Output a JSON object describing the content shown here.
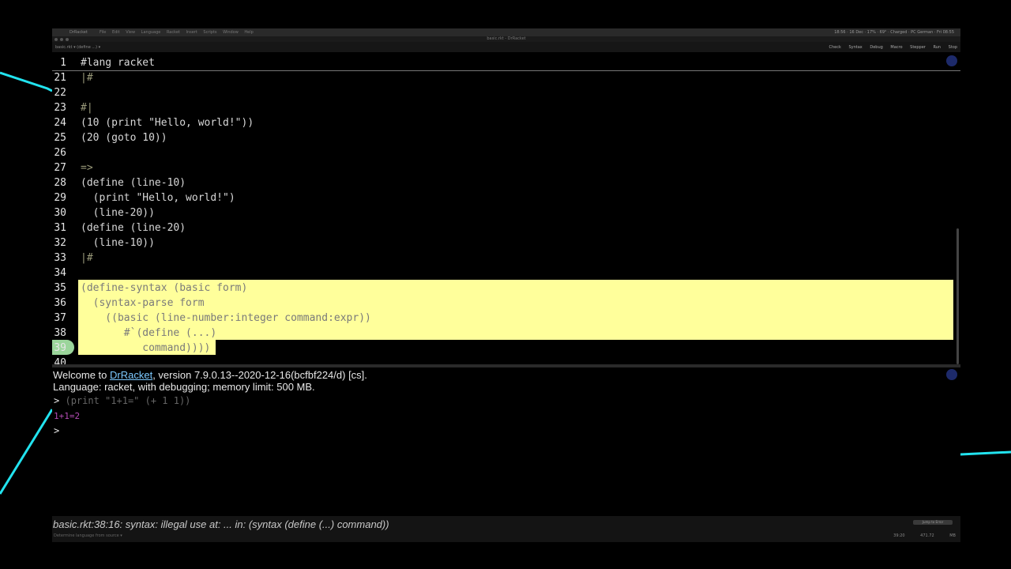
{
  "menubar": {
    "app_name": "DrRacket",
    "menus": "File Edit View Language Racket Insert Scripts Window Help",
    "status": "18:56 · 16 Dec · 17% · 69° · Charged · PC German · Fri 08:55"
  },
  "window_title": "basic.rkt - DrRacket",
  "toolbar": {
    "breadcrumb": "basic.rkt ▾   (define ...) ▾",
    "check_syntax": "Check Syntax",
    "debug": "Debug",
    "macro_stepper": "Macro Stepper",
    "run": "Run",
    "stop": "Stop"
  },
  "editor": {
    "lines": [
      {
        "n": "1",
        "code": "#lang racket"
      },
      {
        "n": "21",
        "code": "|#"
      },
      {
        "n": "22",
        "code": ""
      },
      {
        "n": "23",
        "code": "#|"
      },
      {
        "n": "24",
        "code": "(10 (print \"Hello, world!\"))"
      },
      {
        "n": "25",
        "code": "(20 (goto 10))"
      },
      {
        "n": "26",
        "code": ""
      },
      {
        "n": "27",
        "code": "=>"
      },
      {
        "n": "28",
        "code": "(define (line-10)"
      },
      {
        "n": "29",
        "code": "  (print \"Hello, world!\")"
      },
      {
        "n": "30",
        "code": "  (line-20))"
      },
      {
        "n": "31",
        "code": "(define (line-20)"
      },
      {
        "n": "32",
        "code": "  (line-10))"
      },
      {
        "n": "33",
        "code": "|#"
      },
      {
        "n": "34",
        "code": ""
      },
      {
        "n": "35",
        "code": "(define-syntax (basic form)"
      },
      {
        "n": "36",
        "code": "  (syntax-parse form"
      },
      {
        "n": "37",
        "code": "    ((basic (line-number:integer command:expr))"
      },
      {
        "n": "38",
        "code": "       #`(define (...)"
      },
      {
        "n": "39",
        "code": "          command))))"
      },
      {
        "n": "40",
        "code": ""
      }
    ]
  },
  "repl": {
    "welcome_prefix": "Welcome to ",
    "welcome_link": "DrRacket",
    "welcome_suffix": ", version 7.9.0.13--2020-12-16(bcfbf224/d) [cs].",
    "language_line": "Language: racket, with debugging; memory limit: 500 MB.",
    "prompt_symbol": ">",
    "expr": "(print \"1+1=\" (+ 1 1))",
    "output": "1+1=2",
    "prompt2": ">"
  },
  "status": {
    "error_message": "basic.rkt:38:16: syntax: illegal use at: ... in: (syntax (define (...) command))",
    "footer_left": "Determine language from source ▾",
    "position": "39:20",
    "memory": "471.72 MB",
    "jump_button": "Jump to Error"
  },
  "colors": {
    "highlight": "#ffff9b",
    "link": "#7cc9ff",
    "output": "#b44cb4",
    "accent_glow": "#22e3ef"
  }
}
